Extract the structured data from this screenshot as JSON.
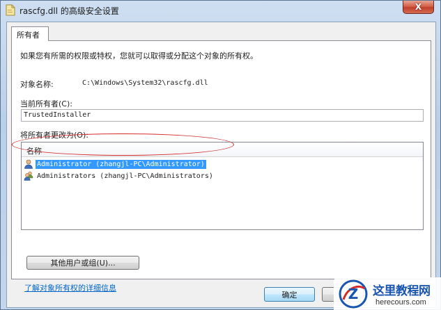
{
  "window": {
    "title": "rascfg.dll 的高级安全设置",
    "close_label": "X"
  },
  "tab": {
    "label": "所有者"
  },
  "panel": {
    "description": "如果您有所需的权限或特权，您就可以取得或分配这个对象的所有权。",
    "object_name_label": "对象名称:",
    "object_name_value": "C:\\Windows\\System32\\rascfg.dll",
    "current_owner_label": "当前所有者(C):",
    "current_owner_value": "TrustedInstaller",
    "change_owner_label": "将所有者更改为(O):",
    "list": {
      "header": "名称",
      "items": [
        {
          "label": "Administrator (zhangjl-PC\\Administrator)",
          "icon": "user-icon",
          "selected": true
        },
        {
          "label": "Administrators (zhangjl-PC\\Administrators)",
          "icon": "users-group-icon",
          "selected": false
        }
      ]
    },
    "other_users_button": "其他用户或组(U)...",
    "learn_more_link": "了解对象所有权的详细信息"
  },
  "buttons": {
    "ok": "确定",
    "cancel": ""
  },
  "watermark": {
    "site_name": "这里教程网",
    "site_url": "herecours.com",
    "logo_letter": "Z"
  },
  "colors": {
    "selection": "#3399ff",
    "highlight_ellipse": "#d3292a",
    "link": "#0066cc",
    "close_button": "#c0402b"
  }
}
